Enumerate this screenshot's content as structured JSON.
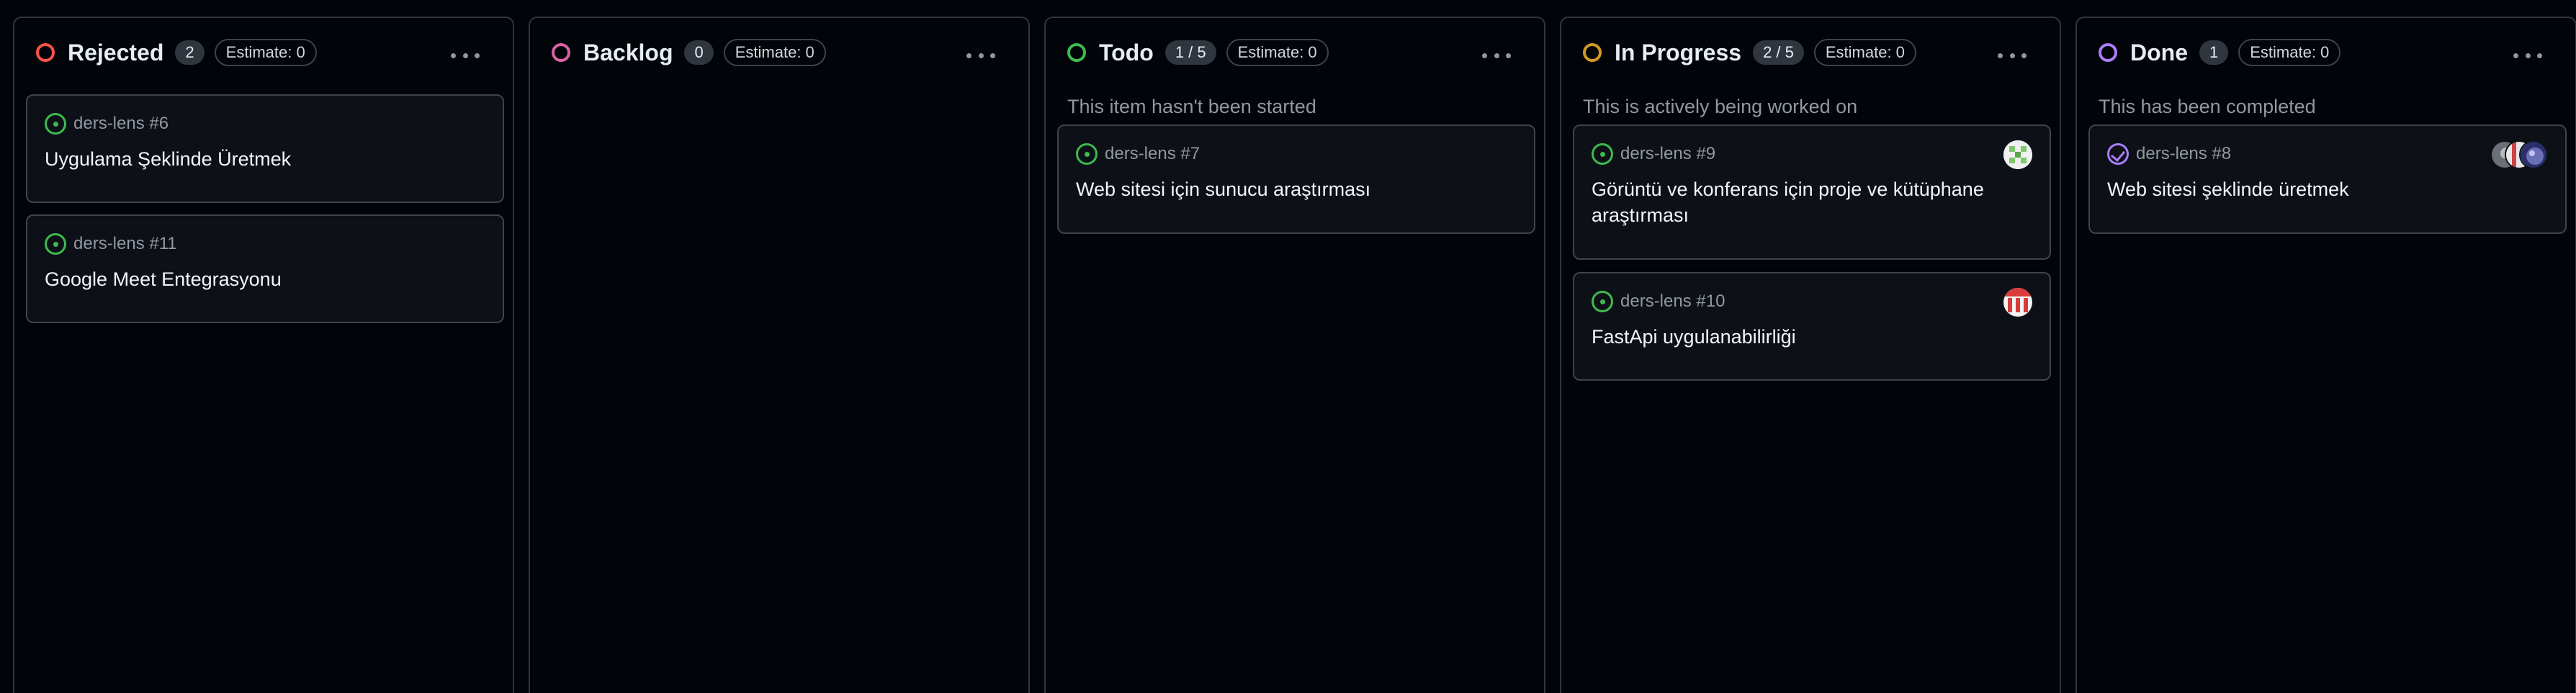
{
  "columns": [
    {
      "title": "Rejected",
      "count": "2",
      "estimate": "Estimate: 0",
      "description": "",
      "status_color": "#f85149",
      "cards": [
        {
          "ref": "ders-lens #6",
          "title": "Uygulama Şeklinde Üretmek",
          "icon": "issue-open-icon"
        },
        {
          "ref": "ders-lens #11",
          "title": "Google Meet Entegrasyonu",
          "icon": "issue-open-icon"
        }
      ]
    },
    {
      "title": "Backlog",
      "count": "0",
      "estimate": "Estimate: 0",
      "description": "",
      "status_color": "#db61a2",
      "cards": []
    },
    {
      "title": "Todo",
      "count": "1 / 5",
      "estimate": "Estimate: 0",
      "description": "This item hasn't been started",
      "status_color": "#3fb950",
      "cards": [
        {
          "ref": "ders-lens #7",
          "title": "Web sitesi için sunucu araştırması",
          "icon": "issue-open-icon"
        }
      ]
    },
    {
      "title": "In Progress",
      "count": "2 / 5",
      "estimate": "Estimate: 0",
      "description": "This is actively being worked on",
      "status_color": "#d29922",
      "cards": [
        {
          "ref": "ders-lens #9",
          "title": "Görüntü ve konferans için proje ve kütüphane araştırması",
          "icon": "issue-open-icon",
          "avatar": "green-pattern-avatar"
        },
        {
          "ref": "ders-lens #10",
          "title": "FastApi uygulanabilirliği",
          "icon": "issue-open-icon",
          "avatar": "red-striped-avatar"
        }
      ]
    },
    {
      "title": "Done",
      "count": "1",
      "estimate": "Estimate: 0",
      "description": "This has been completed",
      "status_color": "#ab7df8",
      "cards": [
        {
          "ref": "ders-lens #8",
          "title": "Web sitesi şeklinde üretmek",
          "icon": "issue-closed-icon",
          "avatar": "stacked-avatars"
        }
      ]
    }
  ],
  "colors": {
    "background": "#010409",
    "card_background": "#0d1117",
    "border": "#30363d",
    "muted_text": "#9198a1",
    "open_issue": "#3fb950",
    "closed_issue": "#ab7df8"
  }
}
